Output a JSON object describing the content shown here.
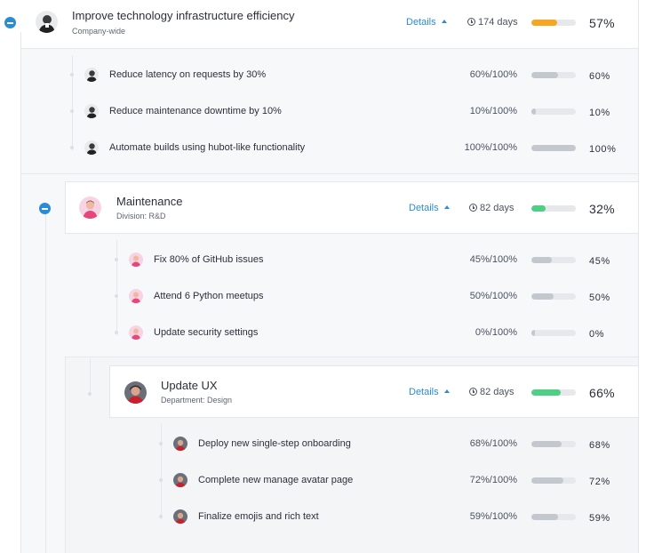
{
  "colors": {
    "accent": "#2b8cd6",
    "bar_track": "#e6e8ec",
    "bar_kr": "#c3c7ce",
    "bar_orange": "#f5a623",
    "bar_green": "#4fce86"
  },
  "objectives": [
    {
      "title": "Improve technology infrastructure efficiency",
      "subtitle": "Company-wide",
      "details_label": "Details",
      "days": "174 days",
      "percent_label": "57%",
      "progress": 0.57,
      "bar_color": "#f5a623",
      "avatar": "person-avatar-gray",
      "key_results": [
        {
          "title": "Reduce latency on requests by 30%",
          "ratio": "60%/100%",
          "percent_label": "60%",
          "progress": 0.6
        },
        {
          "title": "Reduce maintenance downtime by 10%",
          "ratio": "10%/100%",
          "percent_label": "10%",
          "progress": 0.1
        },
        {
          "title": "Automate builds using hubot-like functionality",
          "ratio": "100%/100%",
          "percent_label": "100%",
          "progress": 1.0
        }
      ]
    },
    {
      "title": "Maintenance",
      "subtitle": "Division: R&D",
      "details_label": "Details",
      "days": "82 days",
      "percent_label": "32%",
      "progress": 0.32,
      "bar_color": "#4fce86",
      "avatar": "person-avatar-pink",
      "key_results": [
        {
          "title": "Fix 80% of GitHub issues",
          "ratio": "45%/100%",
          "percent_label": "45%",
          "progress": 0.45
        },
        {
          "title": "Attend 6 Python meetups",
          "ratio": "50%/100%",
          "percent_label": "50%",
          "progress": 0.5
        },
        {
          "title": "Update security settings",
          "ratio": "0%/100%",
          "percent_label": "0%",
          "progress": 0.0
        }
      ]
    },
    {
      "title": "Update UX",
      "subtitle": "Department: Design",
      "details_label": "Details",
      "days": "82 days",
      "percent_label": "66%",
      "progress": 0.66,
      "bar_color": "#4fce86",
      "avatar": "person-avatar-red",
      "key_results": [
        {
          "title": "Deploy new single-step onboarding",
          "ratio": "68%/100%",
          "percent_label": "68%",
          "progress": 0.68
        },
        {
          "title": "Complete new manage avatar page",
          "ratio": "72%/100%",
          "percent_label": "72%",
          "progress": 0.72
        },
        {
          "title": "Finalize emojis and rich text",
          "ratio": "59%/100%",
          "percent_label": "59%",
          "progress": 0.59
        }
      ]
    }
  ]
}
